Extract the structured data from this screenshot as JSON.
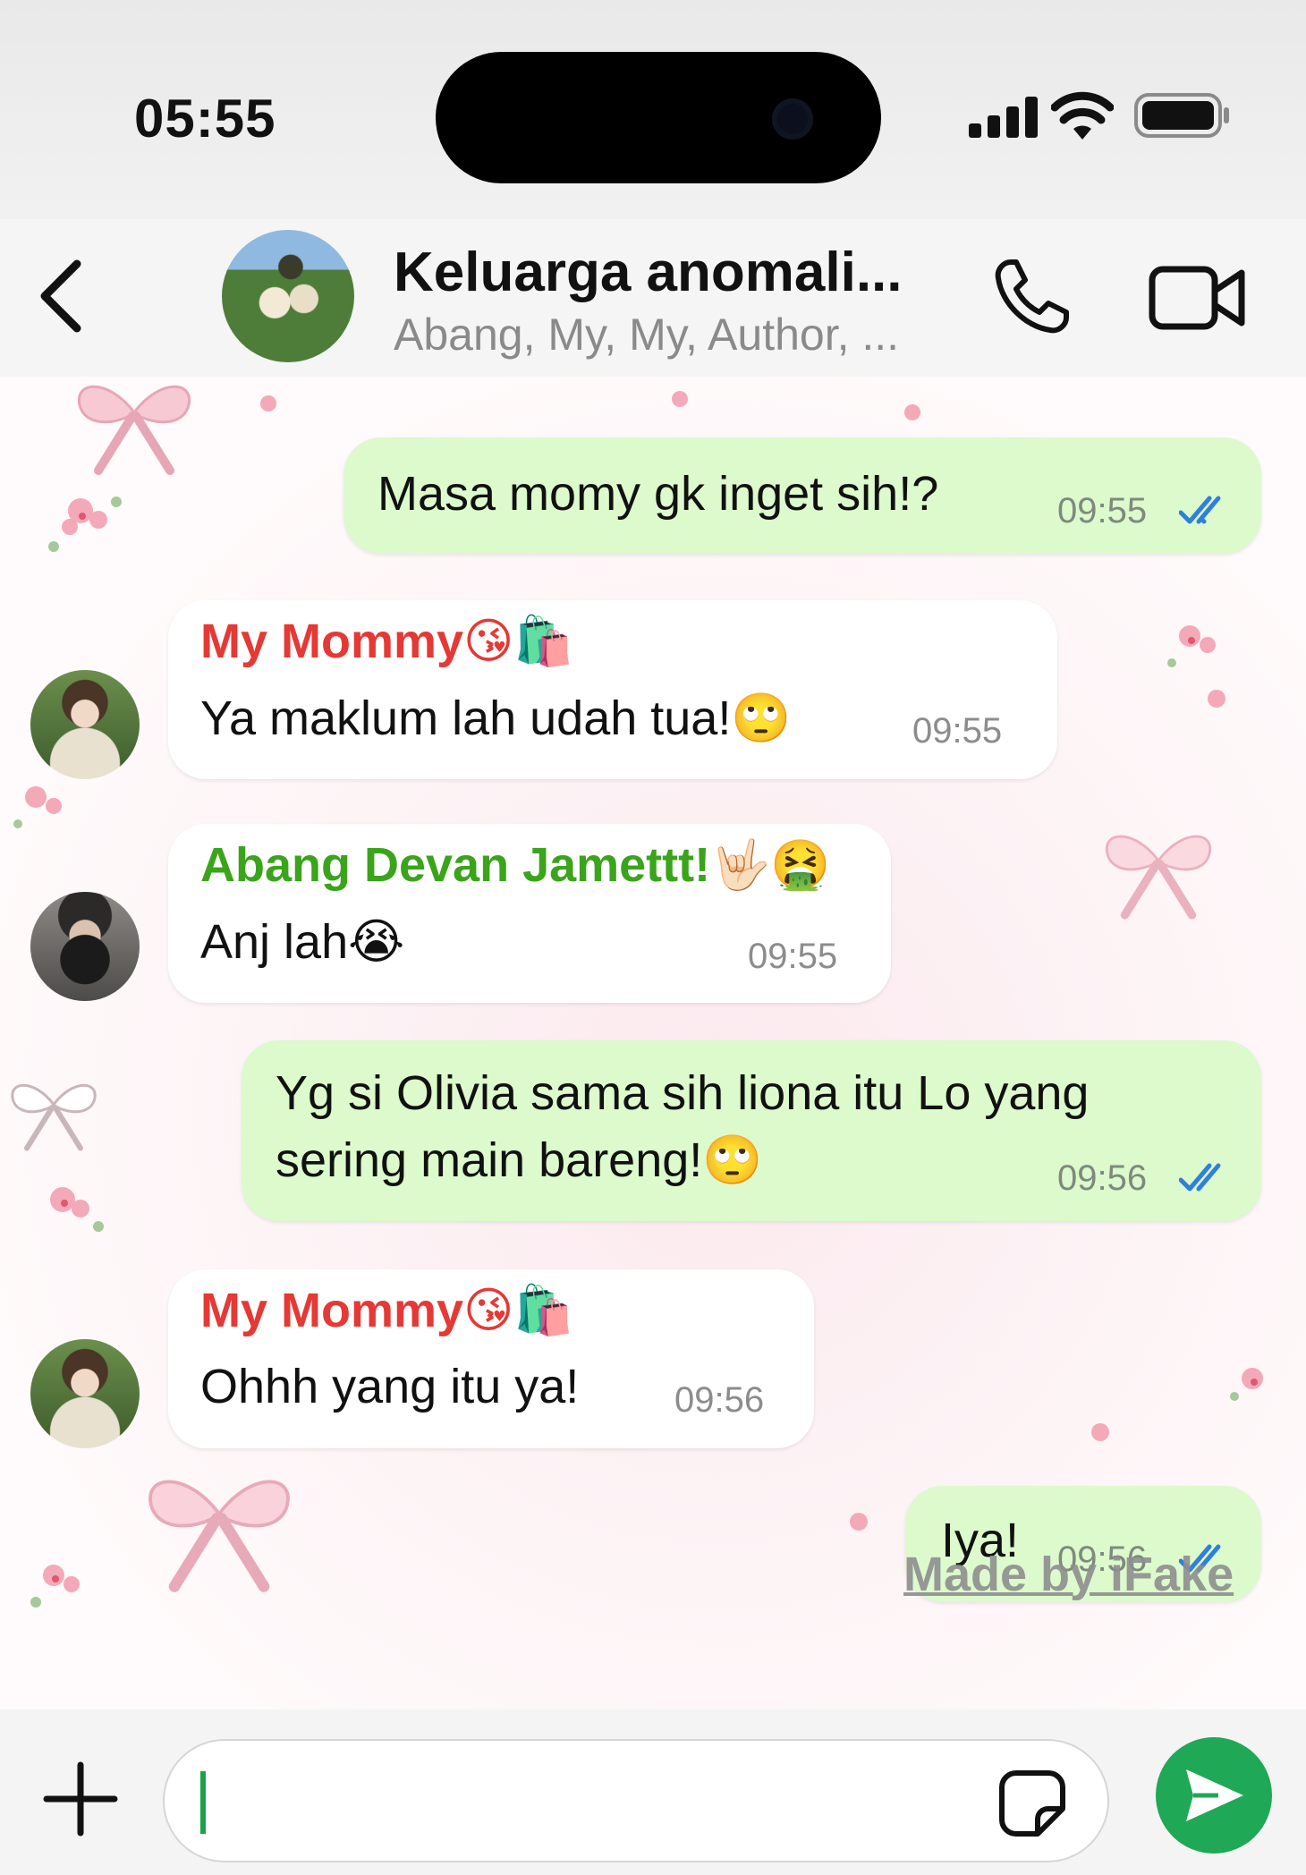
{
  "status_bar": {
    "time": "05:55"
  },
  "header": {
    "title": "Keluarga anomali...",
    "subtitle": "Abang, My, My, Author, ..."
  },
  "messages": [
    {
      "direction": "out",
      "text": "Masa momy gk inget sih!?",
      "time": "09:55",
      "status": "read"
    },
    {
      "direction": "in",
      "sender": "My Mommy",
      "sender_emoji": "😘🛍️",
      "text": "Ya maklum lah udah tua!",
      "text_emoji": "🙄",
      "time": "09:55"
    },
    {
      "direction": "in",
      "sender": "Abang Devan Jamettt!",
      "sender_emoji": "🤟🏻🤮",
      "text": "Anj lah",
      "text_emoji": "😭",
      "time": "09:55"
    },
    {
      "direction": "out",
      "text_line1": "Yg si Olivia sama sih liona itu Lo yang",
      "text_line2": "sering main bareng!",
      "text_emoji": "🙄",
      "time": "09:56",
      "status": "read"
    },
    {
      "direction": "in",
      "sender": "My Mommy",
      "sender_emoji": "😘🛍️",
      "text": "Ohhh yang itu ya!",
      "time": "09:56"
    },
    {
      "direction": "out",
      "text": "Iya!",
      "time": "09:56",
      "status": "read"
    }
  ],
  "watermark": "Made by iFake",
  "input": {
    "value": "",
    "placeholder": ""
  },
  "colors": {
    "outgoing_bubble": "#dcfacc",
    "incoming_bubble": "#ffffff",
    "read_ticks": "#2f7fe0",
    "send_button": "#1fa855",
    "sender_mommy": "#e53935",
    "sender_abang": "#3aa41b"
  },
  "icons": [
    "back-chevron-icon",
    "phone-icon",
    "video-camera-icon",
    "plus-icon",
    "sticker-icon",
    "send-icon",
    "double-check-icon",
    "signal-icon",
    "wifi-icon",
    "battery-icon"
  ]
}
